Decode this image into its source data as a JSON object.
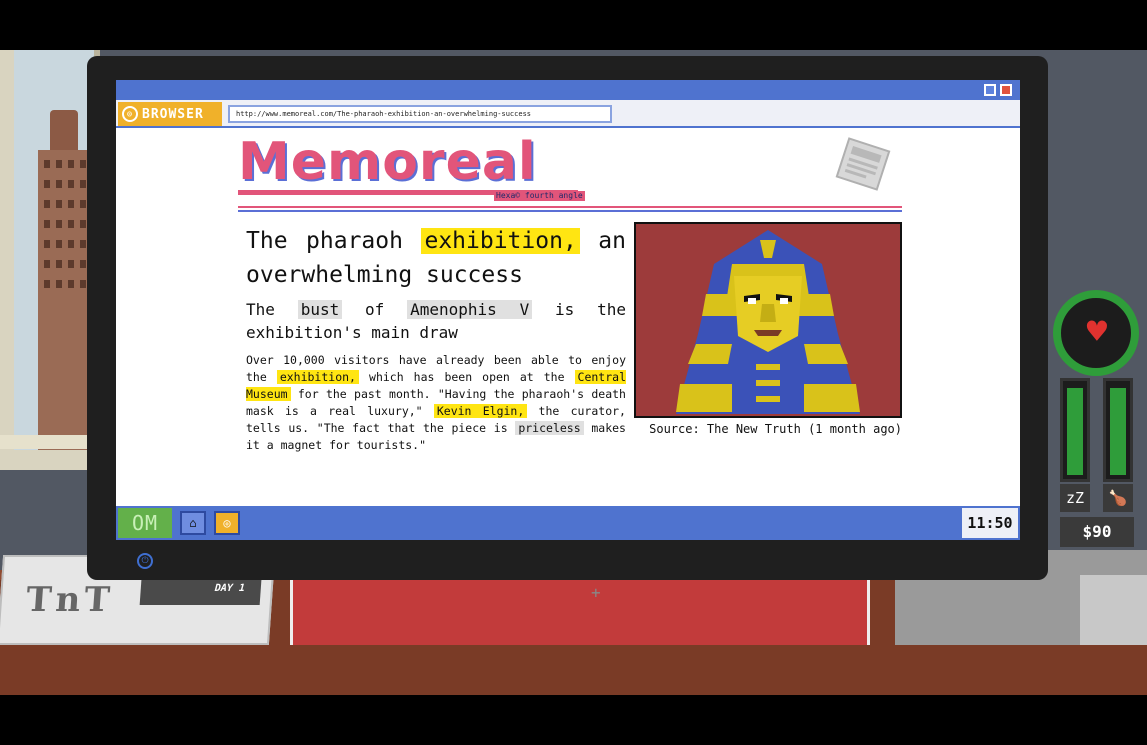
{
  "browser": {
    "tab_label": "BROWSER",
    "url": "http://www.memoreal.com/The-pharaoh-exhibition-an-overwhelming-success"
  },
  "site": {
    "logo": "Memoreal",
    "tagline": "Hexa© fourth angle"
  },
  "article": {
    "headline_parts": [
      "The pharaoh",
      "exhibition,",
      "an overwhelming success"
    ],
    "subhead_parts": [
      "The",
      "bust",
      "of",
      "Amenophis V",
      "is the exhibition's main draw"
    ],
    "body_parts": [
      "Over 10,000 visitors have already been able to enjoy the",
      "exhibition,",
      "which has been open at the",
      "Central Museum",
      "for the past month. \"Having the pharaoh's death mask is a real luxury,\"",
      "Kevin Elgin,",
      "the curator, tells us. \"The fact that the piece is",
      "priceless",
      "makes it a magnet for tourists.\""
    ],
    "image_caption": "Source: The New Truth (1 month ago)",
    "highlight_yellow": "#ffe512",
    "highlight_gray": "#e0e0e0"
  },
  "taskbar": {
    "start_label": "OM",
    "clock": "11:50"
  },
  "hud": {
    "money": "$90",
    "sleep_level": 0.95,
    "food_level": 0.95,
    "health_color": "#2f9d3a"
  },
  "desk": {
    "newspaper_day": "DAY 1",
    "newspaper_logo": "TnT"
  },
  "icons": {
    "browser": "browser-icon",
    "home": "home-icon",
    "heart": "heart-icon",
    "sleep": "sleep-icon",
    "food": "food-icon",
    "power": "power-icon"
  }
}
